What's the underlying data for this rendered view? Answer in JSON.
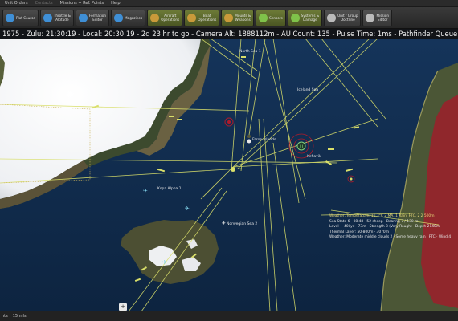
{
  "menubar": {
    "items": [
      {
        "label": "Unit Orders",
        "disabled": false
      },
      {
        "label": "Contacts",
        "disabled": true
      },
      {
        "label": "Missions + Ref. Points",
        "disabled": false
      },
      {
        "label": "Help",
        "disabled": false
      }
    ]
  },
  "toolbar": {
    "buttons": [
      {
        "label": "Plot Course",
        "icon": "globe-icon",
        "color": "#3f8fd6",
        "style": "dark"
      },
      {
        "label": "Throttle &\nAltitude",
        "icon": "gauge-icon",
        "color": "#3f8fd6",
        "style": "dark"
      },
      {
        "label": "Formation\nEditor",
        "icon": "formation-icon",
        "color": "#3f8fd6",
        "style": "dark"
      },
      {
        "label": "Magazines",
        "icon": "magazine-icon",
        "color": "#3f8fd6",
        "style": "dark"
      },
      {
        "label": "Aircraft\nOperations",
        "icon": "aircraft-icon",
        "color": "#c99a3a",
        "style": "green"
      },
      {
        "label": "Boat\nOperations",
        "icon": "boat-icon",
        "color": "#c99a3a",
        "style": "green"
      },
      {
        "label": "Mounts &\nWeapons",
        "icon": "weapons-icon",
        "color": "#c99a3a",
        "style": "green"
      },
      {
        "label": "Sensors",
        "icon": "sensor-icon",
        "color": "#7fc24a",
        "style": "green"
      },
      {
        "label": "Systems &\nDamage",
        "icon": "systems-icon",
        "color": "#7fc24a",
        "style": "green"
      },
      {
        "label": "Unit / Group\nDoctrine",
        "icon": "doctrine-icon",
        "color": "#bbbbbb",
        "style": "plain"
      },
      {
        "label": "Mission\nEditor",
        "icon": "mission-icon",
        "color": "#bbbbbb",
        "style": "plain"
      }
    ]
  },
  "status": {
    "text": "1975 - Zulu: 21:30:19 - Local: 20:30:19 - 2d 23 hr to go - Camera Alt: 1888112m - AU Count: 135 - Pulse Time: 1ms - Pathfinder Queue: 0"
  },
  "map": {
    "place_labels": [
      {
        "text": "North Sea 1",
        "id": "north-sea-1"
      },
      {
        "text": "Faroe Islands",
        "id": "faroe-islands"
      },
      {
        "text": "Iceland Sea",
        "id": "iceland-sea"
      },
      {
        "text": "Norwegian Sea 2",
        "id": "norwegian-sea-2"
      }
    ],
    "unit_labels": [
      {
        "text": "Kopa Alpha 1",
        "id": "unit-kopa"
      },
      {
        "text": "Keflavik",
        "id": "unit-keflavik"
      }
    ],
    "colors": {
      "ocean": "#12304f",
      "ice": "#f2f3f5",
      "land": "#5b5a3e",
      "track": "#d9df6a",
      "hostile": "#b01a2a",
      "unit": "#7fd07a"
    }
  },
  "info_panel": {
    "lines": [
      "Weather, Temperature, 16.3°C 2 MA, 1 Rain, FTC, 2 2 500m",
      "Sea State 6 · 08:48 · 52 sheep · Bearing 7 / 130 m",
      "Level ~ 40kyd · 73m · Strength 8 (Very Rough) · Depth 2140m",
      "Thermal Layer: 50-800m · 3070m",
      "Weather: Moderate middle clouds 2 · Some heavy rain · FTC · Wind 4"
    ]
  },
  "bottom": {
    "label_left": "nts",
    "label_right": "15 mls",
    "expand_symbol": "+"
  }
}
